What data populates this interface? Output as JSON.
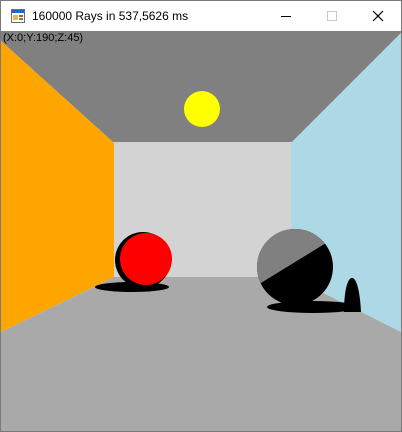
{
  "window": {
    "title": "160000 Rays in 537,5626 ms"
  },
  "titlebar": {
    "app_icon": "window-form-icon",
    "minimize_icon": "minimize-icon",
    "maximize_icon": "maximize-icon",
    "close_icon": "close-icon",
    "maximize_enabled": false
  },
  "render": {
    "camera_label": "(X:0;Y:190;Z:45)",
    "colors": {
      "ceiling": "#808080",
      "back_wall": "#d3d3d3",
      "left_wall": "#ffa500",
      "right_wall": "#add8e6",
      "floor": "#a9a9a9",
      "light": "#ffff00",
      "red_sphere": "#ff0000",
      "gray_sphere": "#808080",
      "shadow": "#000000"
    }
  }
}
